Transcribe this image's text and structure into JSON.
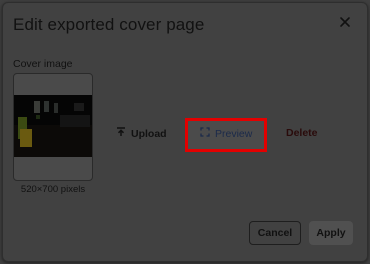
{
  "dialog": {
    "title": "Edit exported cover page",
    "close_icon": "close-icon"
  },
  "cover": {
    "label": "Cover image",
    "size_text": "520×700 pixels"
  },
  "actions": {
    "upload_label": "Upload",
    "upload_icon": "upload-icon",
    "preview_label": "Preview",
    "preview_icon": "fullscreen-icon",
    "delete_label": "Delete"
  },
  "footer": {
    "cancel_label": "Cancel",
    "apply_label": "Apply"
  },
  "colors": {
    "highlight": "#e30000",
    "overlay": "#3f3f3f"
  }
}
